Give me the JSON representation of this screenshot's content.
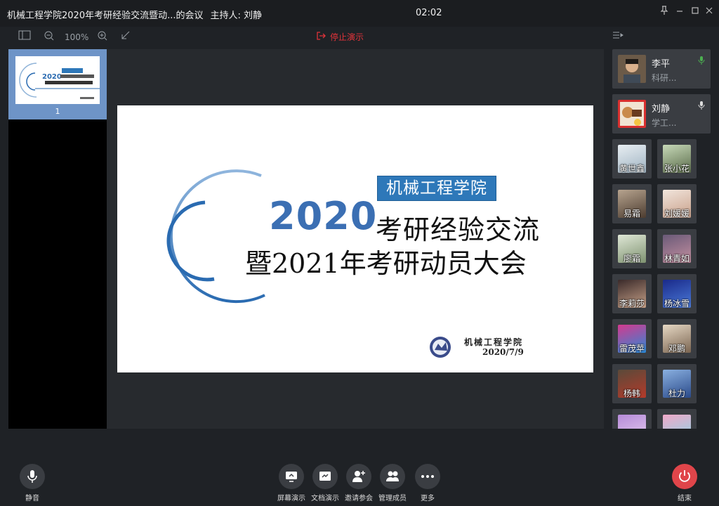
{
  "titlebar": {
    "title": "机械工程学院2020年考研经验交流暨动...的会议",
    "host": "主持人: 刘静",
    "clock": "02:02"
  },
  "toolbar": {
    "zoom": "100%",
    "stop_present": "停止演示"
  },
  "thumbnails": {
    "items": [
      {
        "number": "1"
      }
    ]
  },
  "slide": {
    "college_badge": "机械工程学院",
    "year": "2020",
    "line1": "考研经验交流",
    "line2": "暨2021年考研动员大会",
    "footer_org": "机械工程学院",
    "footer_date": "2020/7/9",
    "logo_caption": "机械工程学院",
    "accent": "#2a6bb1",
    "badge_bg": "#2e78b9"
  },
  "participants_featured": [
    {
      "name": "李平",
      "role": "科研...",
      "mic_color": "#4caf50"
    },
    {
      "name": "刘静",
      "role": "学工...",
      "mic_color": "#dddddd"
    }
  ],
  "participants_grid": [
    {
      "name": "黄世鑫"
    },
    {
      "name": "张小花"
    },
    {
      "name": "易霜"
    },
    {
      "name": "刘媛媛"
    },
    {
      "name": "廖霜"
    },
    {
      "name": "林青如"
    },
    {
      "name": "李莉莎"
    },
    {
      "name": "杨冰雪"
    },
    {
      "name": "雷茂苹"
    },
    {
      "name": "邓鹏"
    },
    {
      "name": "杨韩"
    },
    {
      "name": "杜力"
    },
    {
      "name": ""
    },
    {
      "name": ""
    }
  ],
  "bottombar": {
    "mute": "静音",
    "screen_share": "屏幕演示",
    "doc_share": "文档演示",
    "invite": "邀请参会",
    "manage": "管理成员",
    "more": "更多",
    "end": "结束"
  }
}
